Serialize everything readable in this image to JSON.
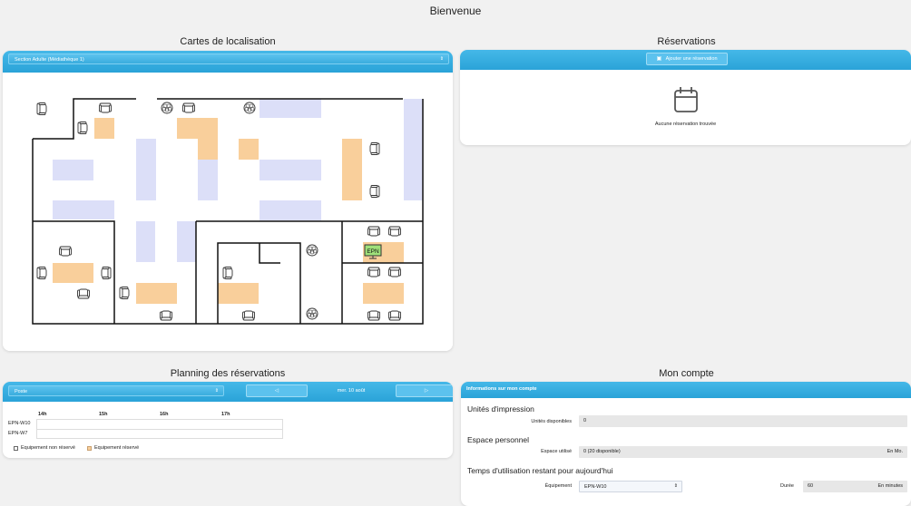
{
  "page": {
    "title": "Bienvenue"
  },
  "map_section": {
    "title": "Cartes de localisation",
    "selected_map": "Section Adulte (Médiathèque 1)",
    "epn_label": "EPN"
  },
  "reservations": {
    "title": "Réservations",
    "add_button": "Ajouter une réservation",
    "empty_text": "Aucune réservation trouvée"
  },
  "planning": {
    "title": "Planning des réservations",
    "filter_value": "Poste",
    "date": "mer. 10 août",
    "hours": [
      "14h",
      "15h",
      "16h",
      "17h"
    ],
    "rows": [
      "EPN-W10",
      "EPN-W7"
    ],
    "legend_unreserved": "Equipement non réservé",
    "legend_reserved": "Equipement réservé",
    "reserved_color": "#f9cf9b"
  },
  "account": {
    "title": "Mon compte",
    "header": "Informations sur mon compte",
    "print_units_heading": "Unités d'impression",
    "units_available_label": "Unités disponibles",
    "units_available_value": "0",
    "personal_space_heading": "Espace personnel",
    "space_used_label": "Espace utilisé",
    "space_used_value": "0 (20 disponible)",
    "space_unit": "En Mo.",
    "time_heading": "Temps d'utilisation restant pour aujourd'hui",
    "equipment_label": "Équipement",
    "equipment_value": "EPN-W10",
    "duration_label": "Durée",
    "duration_value": "60",
    "duration_unit": "En minutes"
  },
  "colors": {
    "accent": "#2aa3d8",
    "table_fill": "#dcdff8",
    "desk_fill": "#f9cf9b",
    "epn_screen": "#9fe07a"
  }
}
